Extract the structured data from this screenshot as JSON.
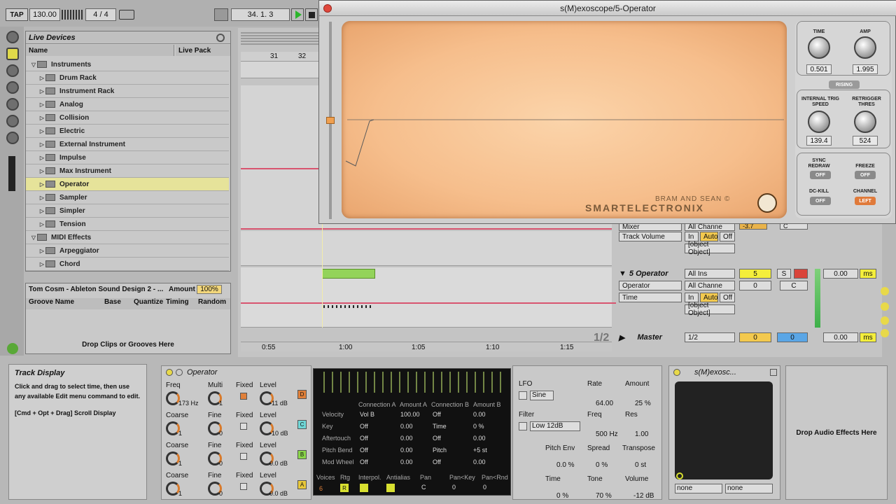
{
  "transport": {
    "tap": "TAP",
    "tempo": "130.00",
    "signature_num": "4",
    "signature_sep": "/",
    "signature_den": "4",
    "position": "34.  1.  3"
  },
  "browser": {
    "title": "Live Devices",
    "col_name": "Name",
    "col_pack": "Live Pack",
    "items": [
      {
        "label": "Instruments",
        "level": 0,
        "open": true
      },
      {
        "label": "Drum Rack",
        "level": 1
      },
      {
        "label": "Instrument Rack",
        "level": 1
      },
      {
        "label": "Analog",
        "level": 1
      },
      {
        "label": "Collision",
        "level": 1
      },
      {
        "label": "Electric",
        "level": 1
      },
      {
        "label": "External Instrument",
        "level": 1
      },
      {
        "label": "Impulse",
        "level": 1
      },
      {
        "label": "Max Instrument",
        "level": 1
      },
      {
        "label": "Operator",
        "level": 1,
        "selected": true
      },
      {
        "label": "Sampler",
        "level": 1
      },
      {
        "label": "Simpler",
        "level": 1
      },
      {
        "label": "Tension",
        "level": 1
      },
      {
        "label": "MIDI Effects",
        "level": 0,
        "open": true
      },
      {
        "label": "Arpeggiator",
        "level": 1
      },
      {
        "label": "Chord",
        "level": 1
      }
    ]
  },
  "groove": {
    "title": "Tom Cosm - Ableton Sound Design 2 - ...",
    "amount_label": "Amount",
    "amount_value": "100%",
    "cols": [
      "Groove Name",
      "Base",
      "Quantize",
      "Timing",
      "Random"
    ],
    "drop_text": "Drop Clips or Grooves Here"
  },
  "arrangement": {
    "bar_31": "31",
    "bar_32": "32",
    "timeline": [
      "0:55",
      "1:00",
      "1:05",
      "1:10",
      "1:15"
    ],
    "zoom": "1/2"
  },
  "mixer": {
    "track_volume": "Track Volume",
    "mixer_label": "Mixer",
    "all_channels": "All Channe",
    "in": "In",
    "auto": "Auto",
    "off": "Off",
    "master": {
      "name": "Master",
      "route": "1/2",
      "v1": "0",
      "v2": "0",
      "delay": "0.00",
      "ms": "ms"
    },
    "val_neg": "-3.7",
    "c": "C",
    "track5": {
      "name": "5 Operator",
      "input": "All Ins",
      "device": "Operator",
      "param": "Time",
      "num": "5",
      "s": "S",
      "zero": "0",
      "delay": "0.00",
      "ms": "ms"
    }
  },
  "plugin": {
    "title": "s(M)exoscope/5-Operator",
    "brand1": "BRAM AND SEAN ©",
    "brand2": "SMARTELECTRONIX",
    "time_label": "TIME",
    "time_val": "0.501",
    "amp_label": "AMP",
    "amp_val": "1.995",
    "rising": "RISING",
    "trig_label": "INTERNAL TRIG SPEED",
    "trig_val": "139.4",
    "retrig_label": "RETRIGGER THRES",
    "retrig_val": "524",
    "sync_label": "SYNC REDRAW",
    "sync_val": "OFF",
    "freeze_label": "FREEZE",
    "freeze_val": "OFF",
    "dckill_label": "DC-KILL",
    "dckill_val": "OFF",
    "channel_label": "CHANNEL",
    "channel_val": "LEFT"
  },
  "info": {
    "title": "Track Display",
    "text1": "Click and drag to select time, then use any available Edit menu command to edit.",
    "text2": "[Cmd + Opt + Drag] Scroll Display"
  },
  "operator": {
    "title": "Operator",
    "freq": "Freq",
    "multi": "Multi",
    "fixed": "Fixed",
    "level": "Level",
    "coarse": "Coarse",
    "fine": "Fine",
    "r1_freq": "173 Hz",
    "r1_multi": "1",
    "r1_level": "-11 dB",
    "r1_letter": "D",
    "r2_coarse": "1",
    "r2_fine": "0",
    "r2_level": "-10 dB",
    "r2_letter": "C",
    "r3_coarse": "1",
    "r3_fine": "0",
    "r3_level": "0.0 dB",
    "r3_letter": "B",
    "r4_coarse": "1",
    "r4_fine": "0",
    "r4_level": "0.0 dB",
    "r4_letter": "A"
  },
  "opdisplay": {
    "conn_a": "Connection A",
    "amt_a": "Amount A",
    "conn_b": "Connection B",
    "amt_b": "Amount B",
    "rows": [
      [
        "Velocity",
        "Vol B",
        "100.00",
        "Off",
        "0.00"
      ],
      [
        "Key",
        "Off",
        "0.00",
        "Time",
        "0 %"
      ],
      [
        "Aftertouch",
        "Off",
        "0.00",
        "Off",
        "0.00"
      ],
      [
        "Pitch Bend",
        "Off",
        "0.00",
        "Pitch",
        "+5 st"
      ],
      [
        "Mod Wheel",
        "Off",
        "0.00",
        "Off",
        "0.00"
      ]
    ],
    "voices": "Voices",
    "rtg": "Rtg",
    "interpol": "Interpol.",
    "antialias": "Antialias",
    "pan": "Pan",
    "pankey": "Pan<Key",
    "panrnd": "Pan<Rnd",
    "voices_val": "6",
    "rtg_val": "R",
    "pan_val": "C",
    "pankey_val": "0",
    "panrnd_val": "0"
  },
  "opright": {
    "lfo": "LFO",
    "lfo_type": "Sine",
    "rate": "Rate",
    "rate_val": "64.00",
    "amount": "Amount",
    "amount_val": "25 %",
    "filter": "Filter",
    "filter_type": "Low 12dB",
    "freq": "Freq",
    "freq_val": "500 Hz",
    "res": "Res",
    "res_val": "1.00",
    "pitch_env": "Pitch Env",
    "pitch_env_val": "0.0 %",
    "spread": "Spread",
    "spread_val": "0 %",
    "transpose": "Transpose",
    "transpose_val": "0 st",
    "time": "Time",
    "time_val": "0 %",
    "tone": "Tone",
    "tone_val": "70 %",
    "volume": "Volume",
    "volume_val": "-12 dB"
  },
  "smexdev": {
    "title": "s(M)exosc...",
    "sel1": "none",
    "sel2": "none"
  },
  "dropfx": {
    "text": "Drop Audio Effects Here"
  }
}
